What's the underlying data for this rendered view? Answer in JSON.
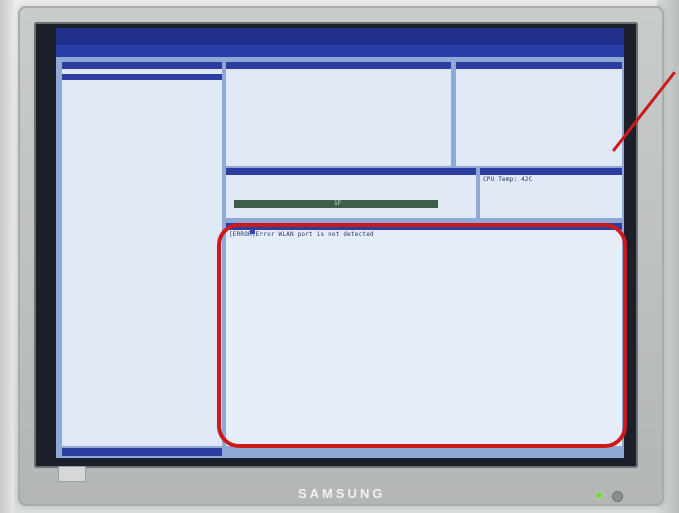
{
  "monitor": {
    "brand": "SAMSUNG"
  },
  "screen": {
    "test_panel": {
      "progress_label": "1F"
    },
    "temperature_panel": {
      "line": "CPU Temp: 42C"
    },
    "message_panel": {
      "text": "[ERROR]Error WLAN port is not detected"
    }
  },
  "annotation": {
    "color": "#cc1a1a"
  }
}
